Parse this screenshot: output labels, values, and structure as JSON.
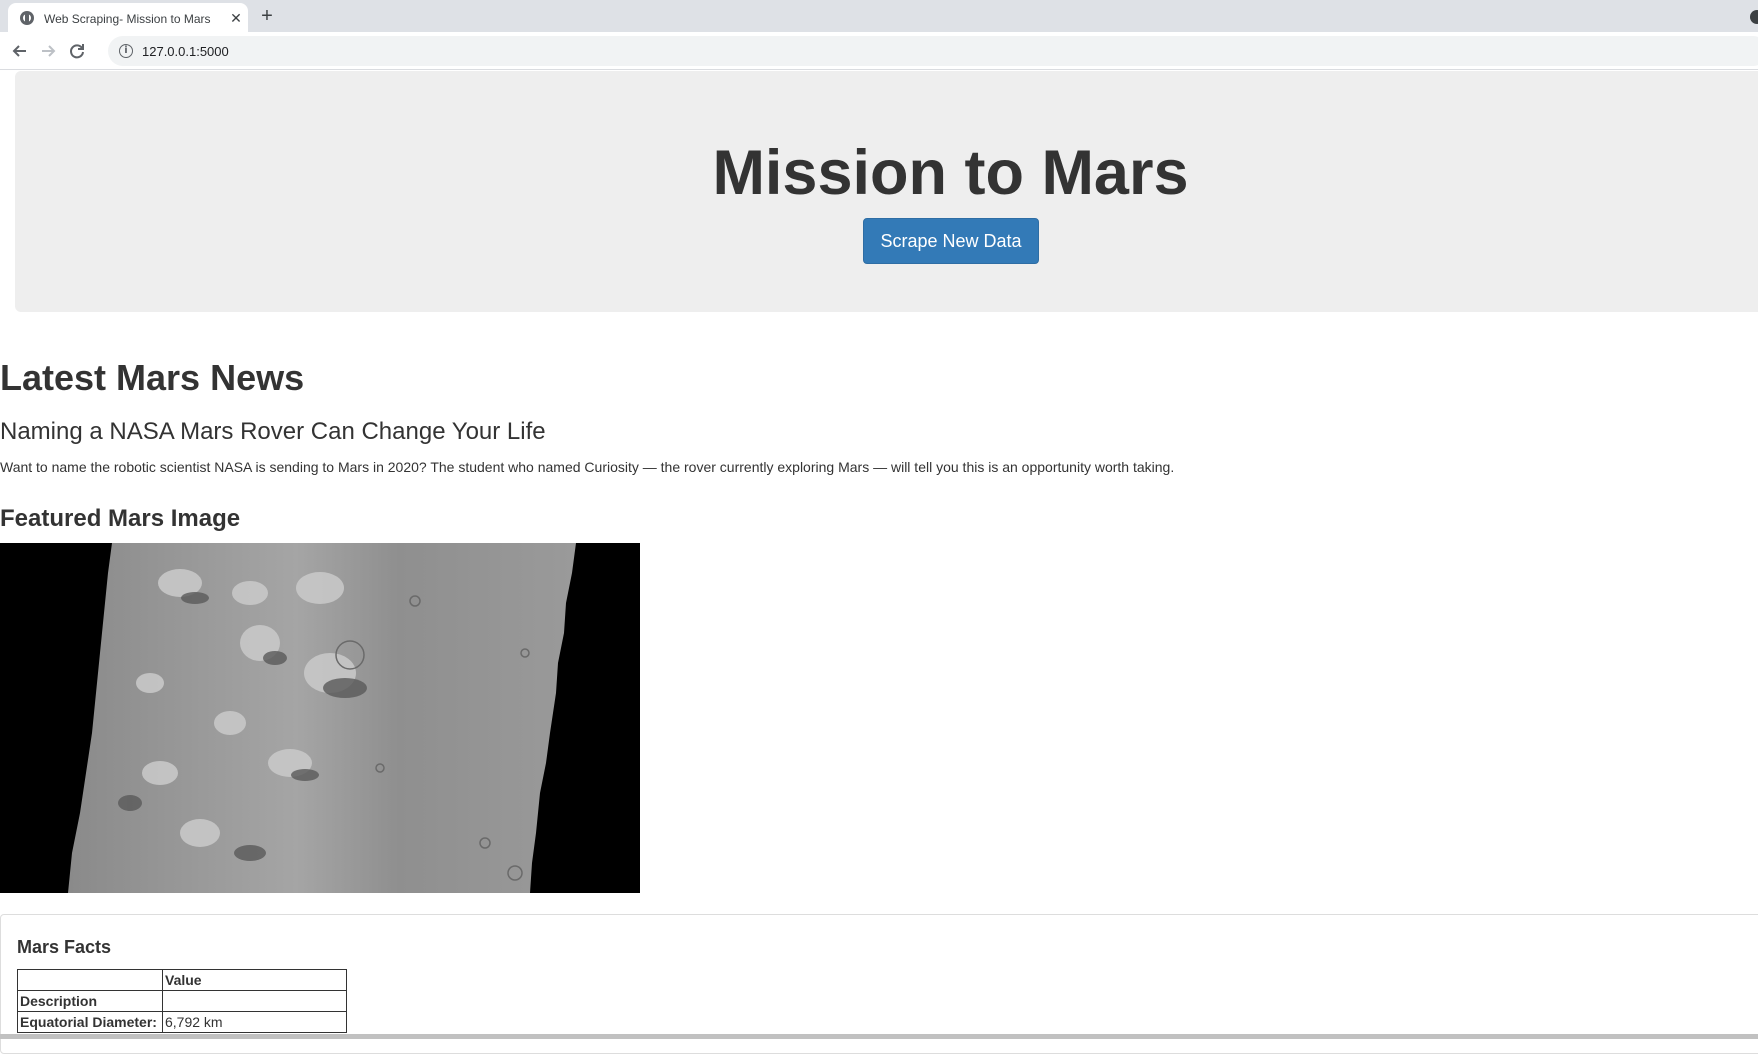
{
  "browser": {
    "tab_title": "Web Scraping- Mission to Mars",
    "tab_close": "✕",
    "new_tab": "+",
    "url": "127.0.0.1:5000",
    "icons": {
      "back": "back-arrow-icon",
      "forward": "forward-arrow-icon",
      "reload": "reload-icon",
      "info": "info-icon",
      "favicon": "globe-icon"
    }
  },
  "jumbotron": {
    "title": "Mission to Mars",
    "button_label": "Scrape New Data"
  },
  "news": {
    "heading": "Latest Mars News",
    "title": "Naming a NASA Mars Rover Can Change Your Life",
    "paragraph": "Want to name the robotic scientist NASA is sending to Mars in 2020? The student who named Curiosity — the rover currently exploring Mars — will tell you this is an opportunity worth taking."
  },
  "featured": {
    "heading": "Featured Mars Image"
  },
  "facts": {
    "heading": "Mars Facts",
    "columns": [
      "",
      "Value"
    ],
    "rows": [
      {
        "label": "Description",
        "value": ""
      },
      {
        "label": "Equatorial Diameter:",
        "value": "6,792 km"
      }
    ]
  },
  "colors": {
    "button": "#337ab7",
    "jumbotron": "#eeeeee",
    "text": "#333333"
  }
}
